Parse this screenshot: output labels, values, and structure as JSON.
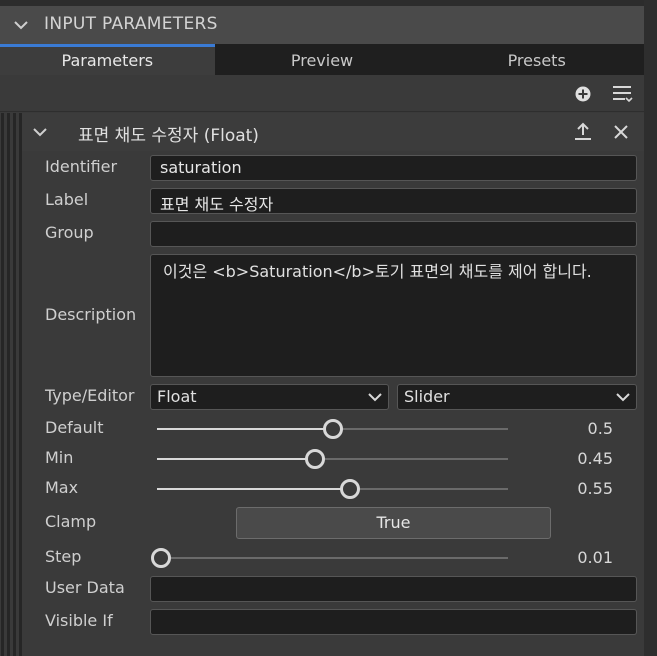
{
  "panel": {
    "title": "INPUT PARAMETERS"
  },
  "tabs": [
    {
      "label": "Parameters",
      "active": true
    },
    {
      "label": "Preview",
      "active": false
    },
    {
      "label": "Presets",
      "active": false
    }
  ],
  "toolbar": {
    "add_icon": "plus-circle-icon",
    "menu_icon": "list-menu-icon"
  },
  "parameter": {
    "title": "표면 채도 수정자 (Float)",
    "fields": {
      "identifier": {
        "label": "Identifier",
        "value": "saturation"
      },
      "label": {
        "label": "Label",
        "value": "표면 채도 수정자"
      },
      "group": {
        "label": "Group",
        "value": ""
      },
      "description": {
        "label": "Description",
        "value": "이것은 <b>Saturation</b>토기 표면의 채도를 제어 합니다."
      },
      "type_editor": {
        "label": "Type/Editor",
        "type": "Float",
        "editor": "Slider"
      },
      "default": {
        "label": "Default",
        "value": "0.5",
        "fraction": 0.5
      },
      "min": {
        "label": "Min",
        "value": "0.45",
        "fraction": 0.45
      },
      "max": {
        "label": "Max",
        "value": "0.55",
        "fraction": 0.55
      },
      "clamp": {
        "label": "Clamp",
        "value": "True"
      },
      "step": {
        "label": "Step",
        "value": "0.01",
        "fraction": 0.01
      },
      "user_data": {
        "label": "User Data",
        "value": ""
      },
      "visible_if": {
        "label": "Visible If",
        "value": ""
      }
    }
  },
  "colors": {
    "accent": "#3a7bd5",
    "background": "#3a3a3a",
    "field_bg": "#1e1e1e"
  }
}
